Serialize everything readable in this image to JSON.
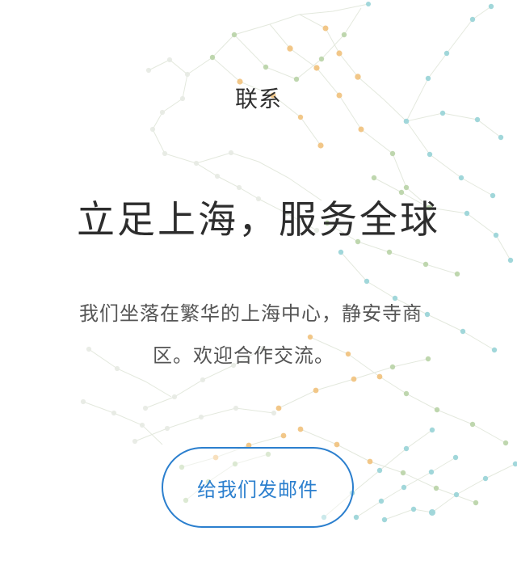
{
  "contact": {
    "eyebrow": "联系",
    "headline": "立足上海，服务全球",
    "description_line_1": "我们坐落在繁华的上海中心，静安寺商",
    "description_line_2": "区。欢迎合作交流。",
    "cta_label": "给我们发邮件"
  },
  "colors": {
    "accent": "#2B7FCE",
    "text_primary": "#2F2F2F",
    "text_secondary": "#555555",
    "network_orange": "#F1C27D",
    "network_green": "#B9D3A7",
    "network_blue": "#9DD5D9",
    "network_gray": "#D6DCD2"
  }
}
